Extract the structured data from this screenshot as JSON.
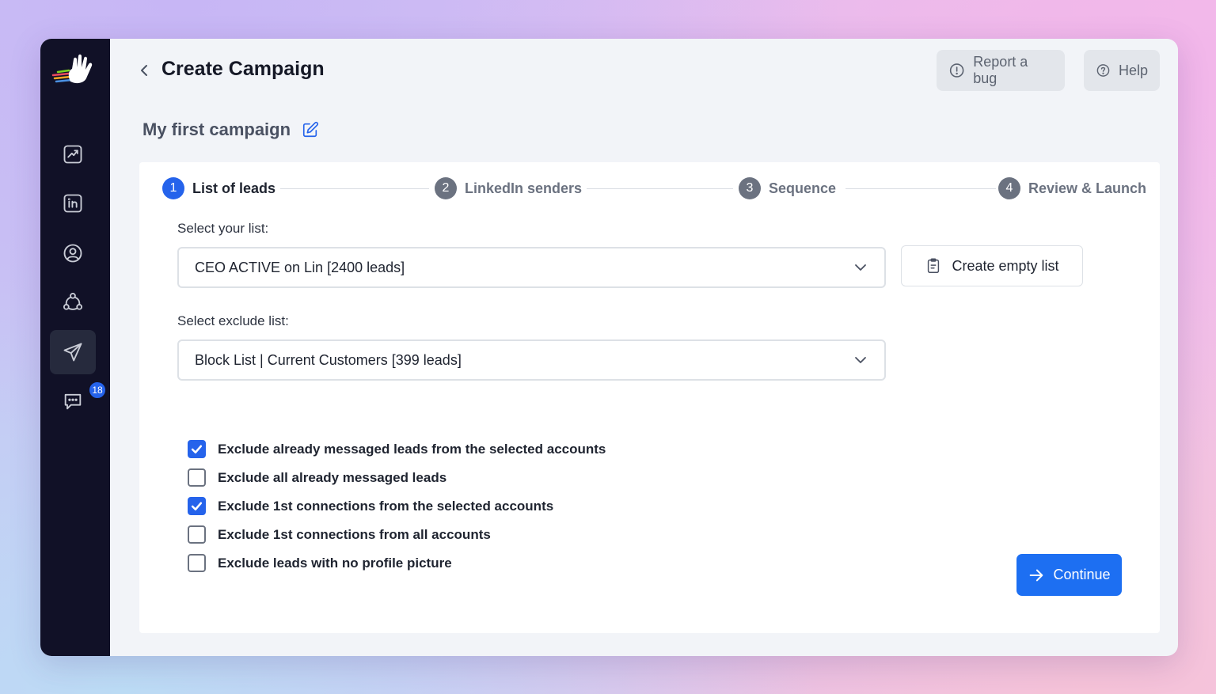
{
  "header": {
    "title": "Create Campaign",
    "report_bug_label": "Report a bug",
    "help_label": "Help"
  },
  "sidebar": {
    "items": [
      {
        "icon": "analytics-icon"
      },
      {
        "icon": "linkedin-icon"
      },
      {
        "icon": "user-circle-icon"
      },
      {
        "icon": "network-icon"
      },
      {
        "icon": "send-icon",
        "active": true
      },
      {
        "icon": "chat-icon",
        "badge": "18"
      }
    ]
  },
  "campaign": {
    "name": "My first campaign"
  },
  "steps": [
    {
      "number": "1",
      "label": "List of leads",
      "active": true
    },
    {
      "number": "2",
      "label": "LinkedIn senders"
    },
    {
      "number": "3",
      "label": "Sequence"
    },
    {
      "number": "4",
      "label": "Review & Launch"
    }
  ],
  "form": {
    "list_label": "Select your list:",
    "list_value": "CEO ACTIVE on Lin [2400 leads]",
    "create_list_label": "Create empty list",
    "exclude_label": "Select exclude list:",
    "exclude_value": "Block List | Current Customers [399 leads]",
    "options": [
      {
        "label": "Exclude already messaged leads from the selected accounts",
        "checked": true
      },
      {
        "label": "Exclude all already messaged leads",
        "checked": false
      },
      {
        "label": "Exclude 1st connections from the selected accounts",
        "checked": true
      },
      {
        "label": "Exclude 1st connections from all accounts",
        "checked": false
      },
      {
        "label": "Exclude leads with no profile picture",
        "checked": false
      }
    ],
    "continue_label": "Continue"
  },
  "colors": {
    "primary": "#2563eb",
    "sidebar_bg": "#111127",
    "step_inactive": "#6b7280"
  }
}
